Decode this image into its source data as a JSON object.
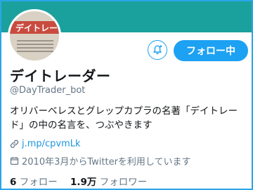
{
  "profile": {
    "name": "デイトレーダー",
    "handle": "@DayTrader_bot",
    "bio": "オリバーベレスとグレップカプラの名著「デイトレード」の中の名言を、つぶやきます",
    "link": "j.mp/cpvmLk",
    "joined": "2010年3月からTwitterを利用しています",
    "avatar_text": "デイトレード"
  },
  "actions": {
    "follow_label": "フォロー中",
    "notify_icon": "bell-plus-icon"
  },
  "stats": {
    "following_count": "6",
    "following_label": "フォロー",
    "followers_count": "1.9万",
    "followers_label": "フォロワー"
  },
  "colors": {
    "accent": "#1da1f2",
    "banner": "#1aa19d",
    "frame": "#2aa5e8",
    "muted": "#657786"
  }
}
